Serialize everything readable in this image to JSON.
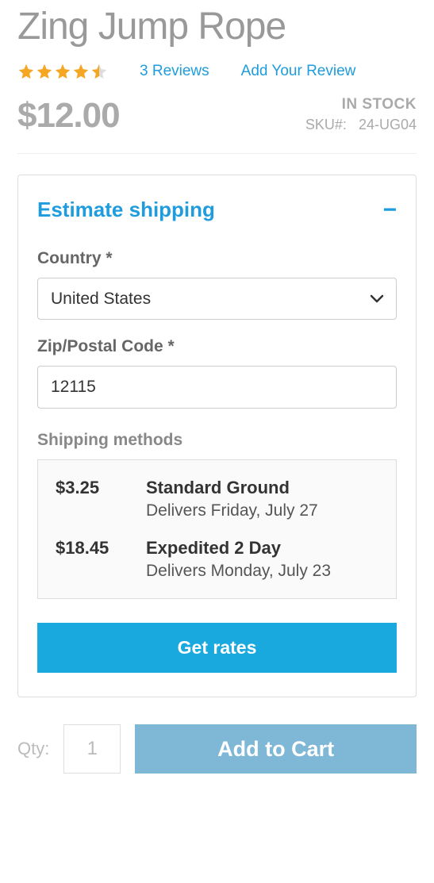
{
  "product": {
    "title": "Zing Jump Rope",
    "rating": 4.5,
    "review_count_text": "3  Reviews",
    "add_review_text": "Add Your Review",
    "price": "$12.00",
    "stock_status": "IN STOCK",
    "sku_label": "SKU#:",
    "sku_value": "24-UG04"
  },
  "shipping": {
    "title": "Estimate shipping",
    "country_label": "Country *",
    "country_value": "United States",
    "zip_label": "Zip/Postal Code *",
    "zip_value": "12115",
    "methods_label": "Shipping methods",
    "methods": [
      {
        "price": "$3.25",
        "name": "Standard Ground",
        "delivery": "Delivers Friday, July 27"
      },
      {
        "price": "$18.45",
        "name": "Expedited 2 Day",
        "delivery": "Delivers Monday, July 23"
      }
    ],
    "get_rates_label": "Get rates"
  },
  "cart": {
    "qty_label": "Qty:",
    "qty_value": "1",
    "add_label": "Add to Cart"
  },
  "colors": {
    "star": "#f5a623",
    "link": "#1f9cdd"
  }
}
